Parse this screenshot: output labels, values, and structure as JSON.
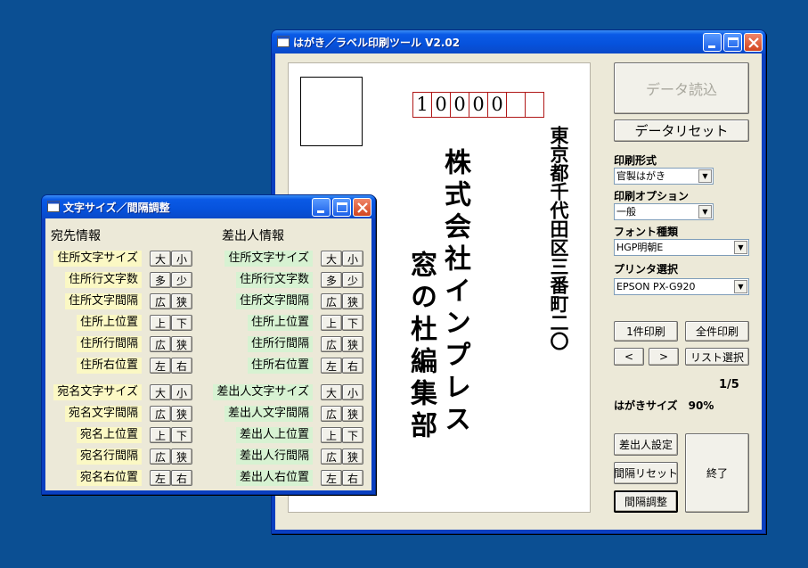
{
  "main_window": {
    "title": "はがき／ラベル印刷ツール V2.02",
    "postal_code": [
      "1",
      "0",
      "0",
      "0",
      "0",
      "",
      ""
    ],
    "address": "東京都千代田区三番町二〇",
    "recipient_line1": "株式会社インプレス",
    "recipient_line2": "窓の杜編集部",
    "panel": {
      "load_data": "データ読込",
      "reset_data": "データリセット",
      "print_format_label": "印刷形式",
      "print_format_value": "官製はがき",
      "print_option_label": "印刷オプション",
      "print_option_value": "一般",
      "font_type_label": "フォント種類",
      "font_type_value": "HGP明朝E",
      "printer_label": "プリンタ選択",
      "printer_value": "EPSON PX-G920",
      "print_one": "1件印刷",
      "print_all": "全件印刷",
      "prev": "<",
      "next": ">",
      "list_select": "リスト選択",
      "page_counter": "1/5",
      "postcard_size": "はがきサイズ　90%",
      "sender_settings": "差出人設定",
      "spacing_reset": "間隔リセット",
      "spacing_adjust": "間隔調整",
      "exit": "終了"
    }
  },
  "sub_window": {
    "title": "文字サイズ／間隔調整",
    "left_header": "宛先情報",
    "right_header": "差出人情報",
    "left_rows": [
      {
        "label": "住所文字サイズ",
        "b1": "大",
        "b2": "小"
      },
      {
        "label": "住所行文字数",
        "b1": "多",
        "b2": "少"
      },
      {
        "label": "住所文字間隔",
        "b1": "広",
        "b2": "狭"
      },
      {
        "label": "住所上位置",
        "b1": "上",
        "b2": "下"
      },
      {
        "label": "住所行間隔",
        "b1": "広",
        "b2": "狭"
      },
      {
        "label": "住所右位置",
        "b1": "左",
        "b2": "右"
      },
      {
        "label": "宛名文字サイズ",
        "b1": "大",
        "b2": "小"
      },
      {
        "label": "宛名文字間隔",
        "b1": "広",
        "b2": "狭"
      },
      {
        "label": "宛名上位置",
        "b1": "上",
        "b2": "下"
      },
      {
        "label": "宛名行間隔",
        "b1": "広",
        "b2": "狭"
      },
      {
        "label": "宛名右位置",
        "b1": "左",
        "b2": "右"
      }
    ],
    "right_rows": [
      {
        "label": "住所文字サイズ",
        "b1": "大",
        "b2": "小"
      },
      {
        "label": "住所行文字数",
        "b1": "多",
        "b2": "少"
      },
      {
        "label": "住所文字間隔",
        "b1": "広",
        "b2": "狭"
      },
      {
        "label": "住所上位置",
        "b1": "上",
        "b2": "下"
      },
      {
        "label": "住所行間隔",
        "b1": "広",
        "b2": "狭"
      },
      {
        "label": "住所右位置",
        "b1": "左",
        "b2": "右"
      },
      {
        "label": "差出人文字サイズ",
        "b1": "大",
        "b2": "小"
      },
      {
        "label": "差出人文字間隔",
        "b1": "広",
        "b2": "狭"
      },
      {
        "label": "差出人上位置",
        "b1": "上",
        "b2": "下"
      },
      {
        "label": "差出人行間隔",
        "b1": "広",
        "b2": "狭"
      },
      {
        "label": "差出人右位置",
        "b1": "左",
        "b2": "右"
      }
    ]
  }
}
